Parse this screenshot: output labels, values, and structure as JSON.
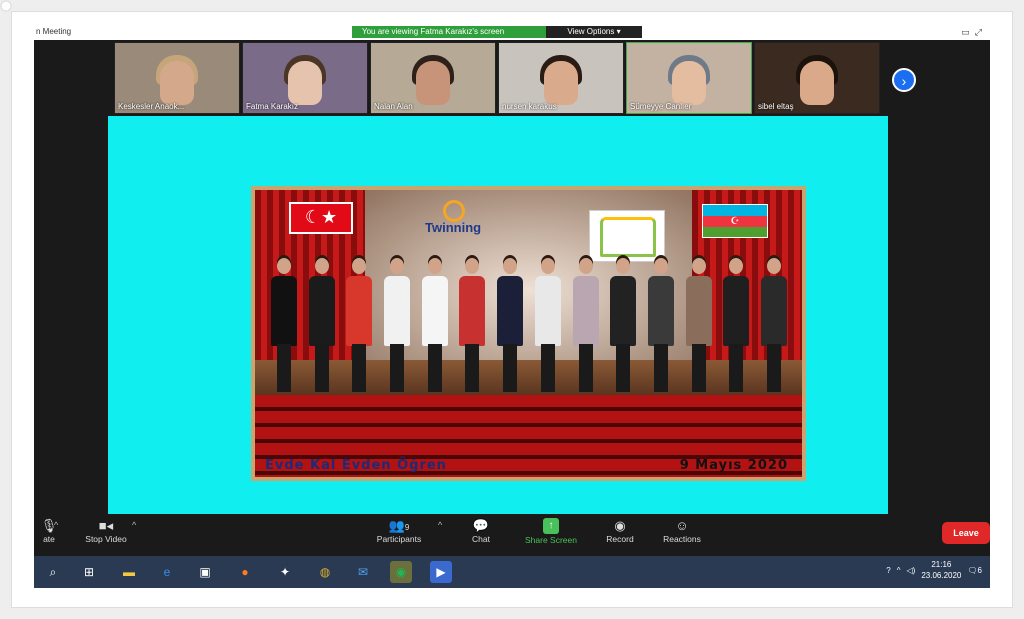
{
  "window": {
    "title": "n Meeting",
    "share_banner": "You are viewing Fatma Karakız's screen",
    "view_options": "View Options ▾"
  },
  "participants": [
    {
      "name": "Keskesler Anaok...",
      "bg": "#9a8a7a",
      "skin": "#d3a88b",
      "hair": "#c6a57a"
    },
    {
      "name": "Fatma Karakız",
      "bg": "#7a6b88",
      "skin": "#e6c3ad",
      "hair": "#4a3526"
    },
    {
      "name": "Nalan Alan",
      "bg": "#b6a995",
      "skin": "#c89479",
      "hair": "#2e211a"
    },
    {
      "name": "nursen karakus",
      "bg": "#c9c3be",
      "skin": "#d9ab8c",
      "hair": "#2a1c14"
    },
    {
      "name": "Sümeyye Canlıer",
      "bg": "#c3b2a1",
      "skin": "#e4bca0",
      "hair": "#6e7a88"
    },
    {
      "name": "sibel eltaş",
      "bg": "#3a2a20",
      "skin": "#d9a98a",
      "hair": "#1b120c"
    }
  ],
  "poster": {
    "twinning": "Twinning",
    "caption_left": "Evde Kal Evden Öğren",
    "caption_right": "9 Mayıs 2020",
    "people_colors": [
      "#111111",
      "#1b1b1b",
      "#d8372c",
      "#f1f1f1",
      "#f5f5f5",
      "#c7312f",
      "#1c1f38",
      "#e8e8e8",
      "#b9a6b0",
      "#222222",
      "#3a3a3a",
      "#8a6e5b",
      "#1f1f1f",
      "#2a2a2a"
    ]
  },
  "toolbar": {
    "mute_label": "ate",
    "stop_video": "Stop Video",
    "participants": "Participants",
    "participants_count": "9",
    "chat": "Chat",
    "share_screen": "Share Screen",
    "record": "Record",
    "reactions": "Reactions",
    "leave": "Leave"
  },
  "taskbar": {
    "time": "21:16",
    "date": "23.06.2020",
    "notifications": "6"
  }
}
